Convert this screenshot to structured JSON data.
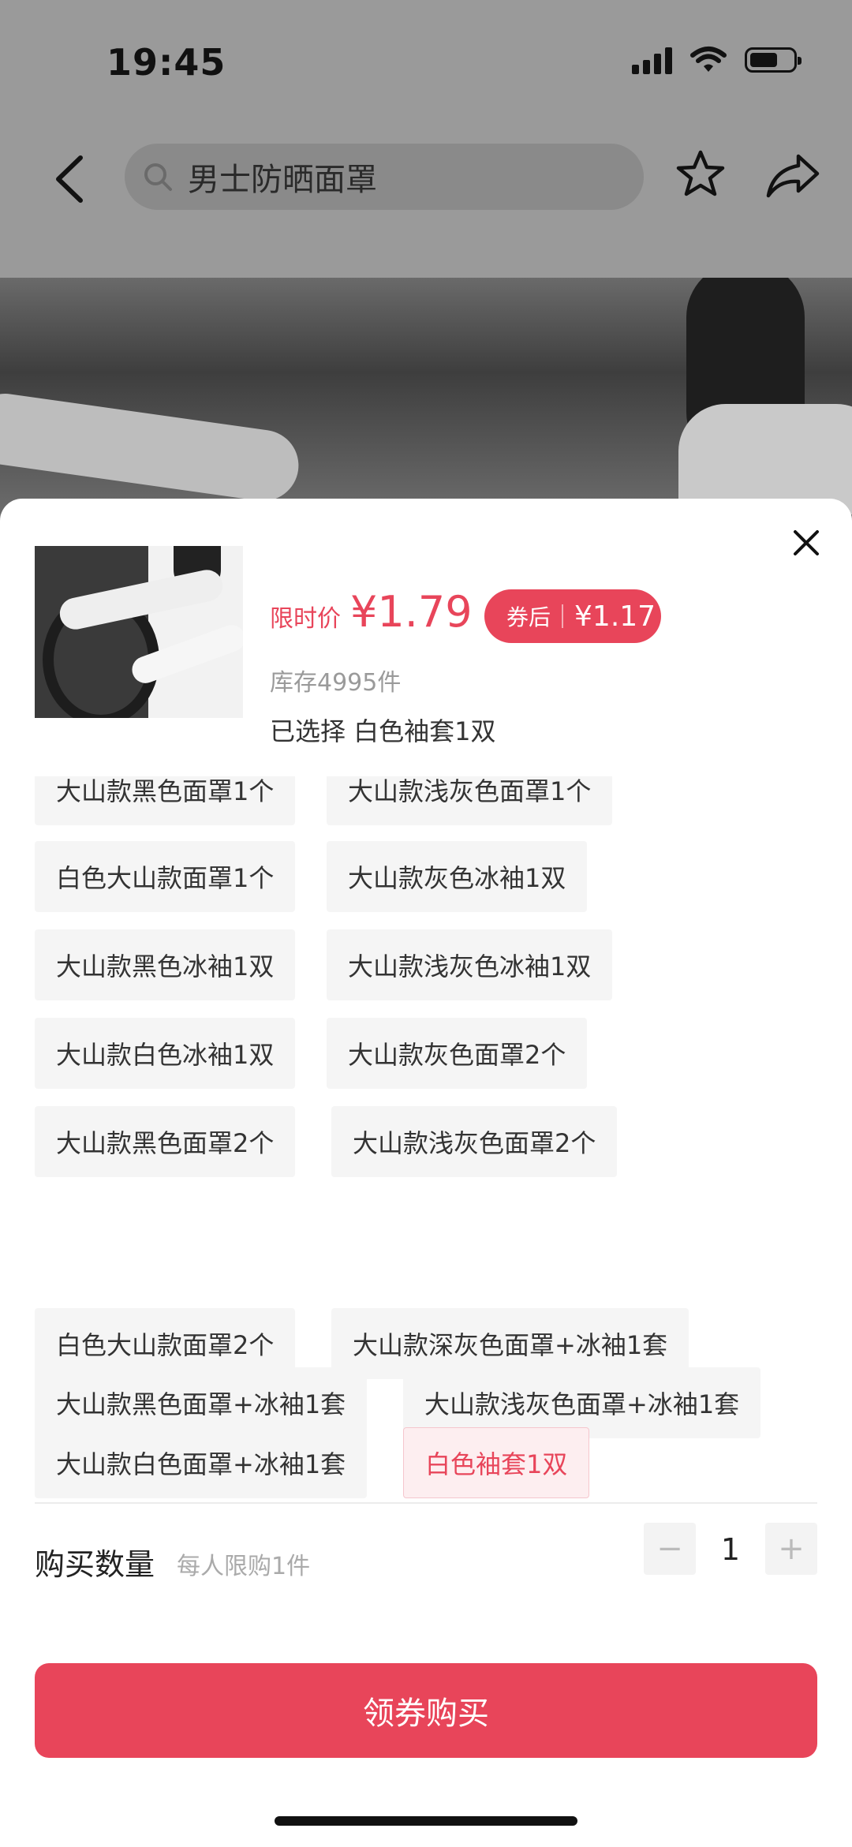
{
  "status_bar": {
    "time": "19:45"
  },
  "header": {
    "search_text": "男士防晒面罩"
  },
  "product": {
    "price_label": "限时价",
    "price": "¥1.79",
    "coupon_label": "券后",
    "coupon_price": "¥1.17",
    "stock": "库存4995件",
    "selected_text": "已选择 白色袖套1双"
  },
  "options": [
    {
      "label": "大山款黑色面罩1个",
      "selected": false
    },
    {
      "label": "大山款浅灰色面罩1个",
      "selected": false
    },
    {
      "label": "白色大山款面罩1个",
      "selected": false
    },
    {
      "label": "大山款灰色冰袖1双",
      "selected": false
    },
    {
      "label": "大山款黑色冰袖1双",
      "selected": false
    },
    {
      "label": "大山款浅灰色冰袖1双",
      "selected": false
    },
    {
      "label": "大山款白色冰袖1双",
      "selected": false
    },
    {
      "label": "大山款灰色面罩2个",
      "selected": false
    },
    {
      "label": "大山款黑色面罩2个",
      "selected": false
    },
    {
      "label": "大山款浅灰色面罩2个",
      "selected": false
    },
    {
      "label": "白色大山款面罩2个",
      "selected": false
    },
    {
      "label": "大山款深灰色面罩+冰袖1套",
      "selected": false
    },
    {
      "label": "大山款黑色面罩+冰袖1套",
      "selected": false
    },
    {
      "label": "大山款浅灰色面罩+冰袖1套",
      "selected": false
    },
    {
      "label": "大山款白色面罩+冰袖1套",
      "selected": false
    },
    {
      "label": "白色袖套1双",
      "selected": true
    }
  ],
  "quantity": {
    "label": "购买数量",
    "limit": "每人限购1件",
    "minus": "−",
    "value": "1",
    "plus": "+"
  },
  "buy_button": "领券购买",
  "colors": {
    "accent": "#e8455a",
    "chip_bg": "#f5f5f5",
    "selected_bg": "#fdeef0"
  }
}
